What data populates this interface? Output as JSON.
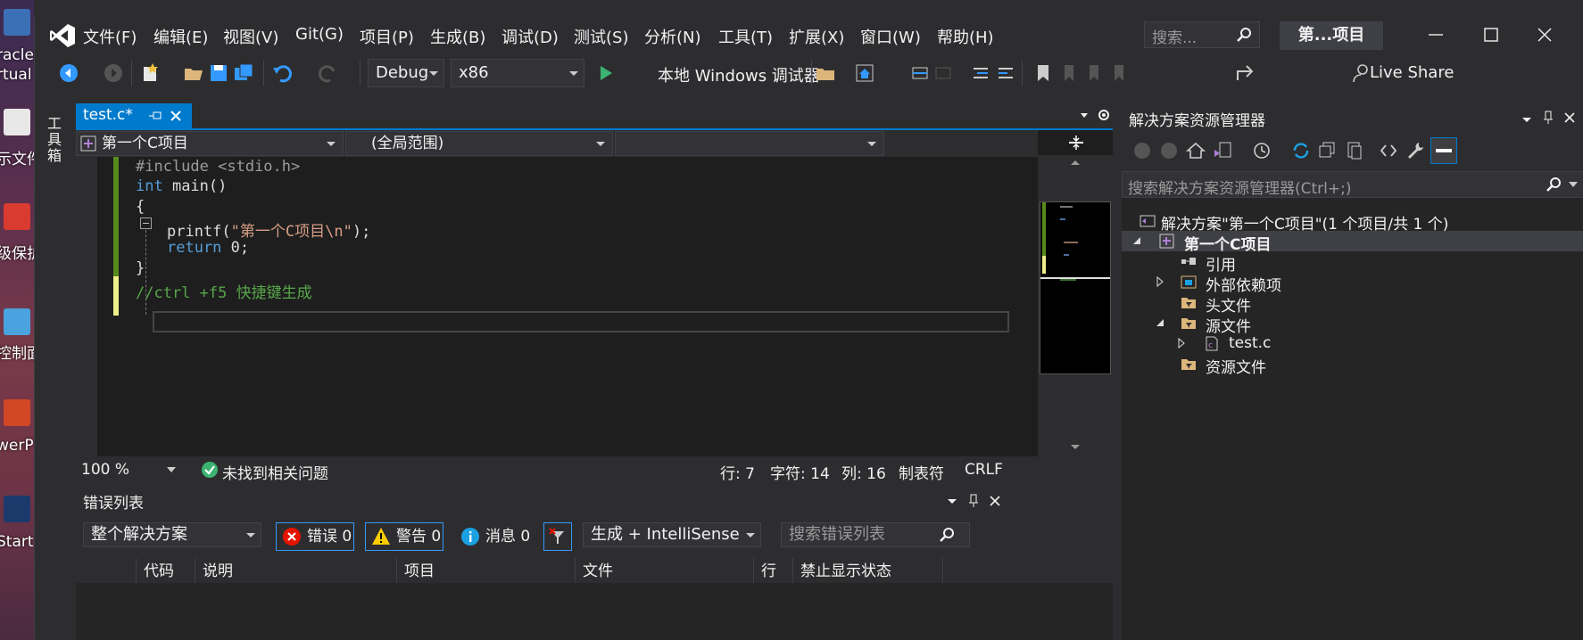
{
  "desktop": {
    "labels": [
      "racle",
      "rtual",
      "示文件",
      "级保护",
      "控制面",
      "werP",
      "Start"
    ]
  },
  "menu": {
    "items": [
      "文件(F)",
      "编辑(E)",
      "视图(V)",
      "Git(G)",
      "项目(P)",
      "生成(B)",
      "调试(D)",
      "测试(S)",
      "分析(N)",
      "工具(T)",
      "扩展(X)",
      "窗口(W)",
      "帮助(H)"
    ],
    "search_placeholder": "搜索...",
    "project_title": "第...项目"
  },
  "toolbar": {
    "config": "Debug",
    "platform": "x86",
    "debugger": "本地 Windows 调试器",
    "live_share": "Live Share"
  },
  "toolbox": {
    "label": "工具箱"
  },
  "editor": {
    "tab_label": "test.c*",
    "nav_project": "第一个C项目",
    "nav_scope": "(全局范围)",
    "nav_member": "",
    "code": {
      "line1_pp": "#include",
      "line1_hdr": " <stdio.h>",
      "line2_kw": "int",
      "line2_rest": " main()",
      "line3": "{",
      "line4_fn": "printf(",
      "line4_str": "\"第一个C项目\\n\"",
      "line4_end": ");",
      "line5_kw": "return",
      "line5_rest": " 0;",
      "line6": "}",
      "line7_comment": "//ctrl +f5 快捷键生成"
    },
    "status": {
      "zoom": "100 %",
      "issues": "未找到相关问题",
      "line": "行: 7",
      "char": "字符: 14",
      "col": "列: 16",
      "tabs": "制表符",
      "eol": "CRLF"
    }
  },
  "error_list": {
    "title": "错误列表",
    "scope": "整个解决方案",
    "errors": "错误 0",
    "warnings": "警告 0",
    "messages": "消息 0",
    "source": "生成 + IntelliSense",
    "search_placeholder": "搜索错误列表",
    "columns": [
      "代码",
      "说明",
      "项目",
      "文件",
      "行",
      "禁止显示状态"
    ]
  },
  "solution_explorer": {
    "title": "解决方案资源管理器",
    "search_placeholder": "搜索解决方案资源管理器(Ctrl+;)",
    "solution": "解决方案\"第一个C项目\"(1 个项目/共 1 个)",
    "project": "第一个C项目",
    "references": "引用",
    "external_deps": "外部依赖项",
    "headers": "头文件",
    "sources": "源文件",
    "source_file": "test.c",
    "resources": "资源文件"
  },
  "colors": {
    "accent": "#007acc",
    "keyword": "#569cd6",
    "string": "#d69d85",
    "comment": "#57a64a"
  }
}
